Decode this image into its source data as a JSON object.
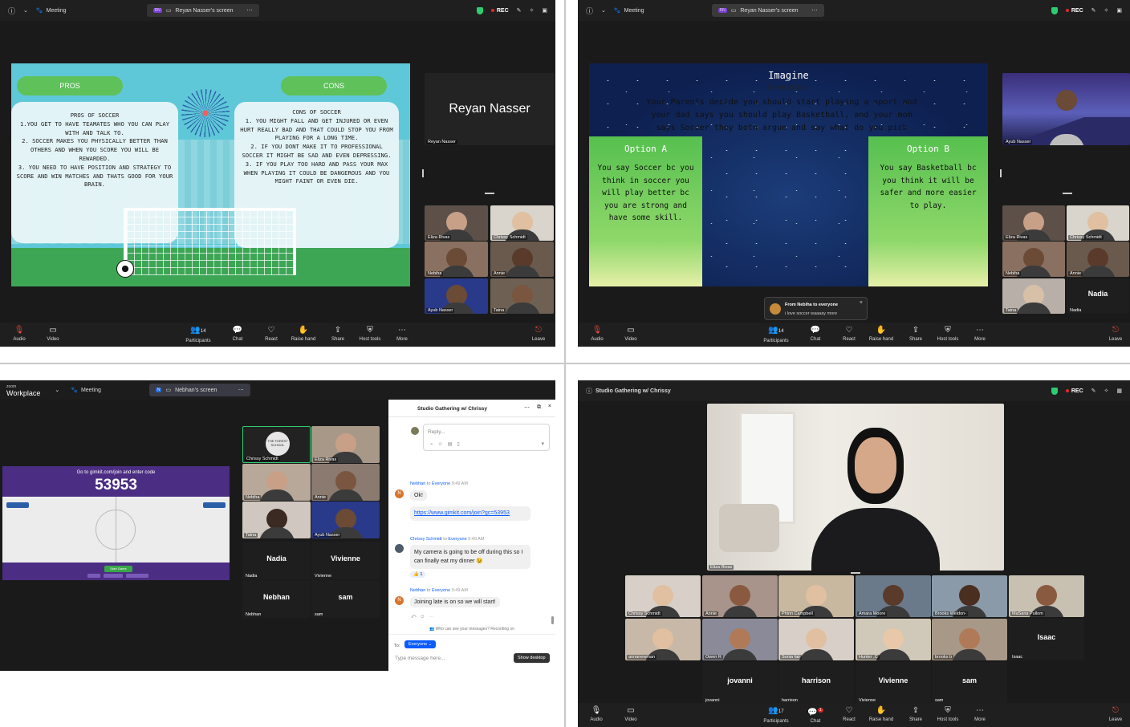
{
  "p1": {
    "meeting": "Meeting",
    "share_tab": "Reyan Nasser's screen",
    "rec": "REC",
    "slide": {
      "pros_head": "PROS",
      "cons_head": "CONS",
      "pros_title": "PROS OF SOCCER",
      "pros_items": [
        "1.YOU GET TO HAVE TEAMATES WHO YOU CAN PLAY WITH AND TALK TO.",
        "2.    SOCCER MAKES YOU PHYSICALLY BETTER THAN OTHERS AND WHEN YOU SCORE YOU WILL BE REWARDED.",
        "3.    YOU NEED TO HAVE POSITION AND STRATEGY TO SCORE AND WIN MATCHES AND THATS GOOD FOR YOUR BRAIN."
      ],
      "cons_title": "CONS OF SOCCER",
      "cons_items": [
        "1.   YOU MIGHT FALL AND GET INJURED OR EVEN HURT REALLY BAD AND THAT COULD STOP YOU FROM PLAYING FOR A LONG TIME.",
        "2.   IF YOU DONT MAKE IT TO PROFESSIONAL SOCCER IT MIGHT BE SAD AND EVEN DEPRESSING.",
        "3.   IF YOU PLAY TOO HARD AND PASS YOUR MAX WHEN PLAYING IT COULD BE DANGEROUS AND YOU MIGHT FAINT OR EVEN DIE."
      ]
    },
    "speaker_big": "Reyan Nasser",
    "speaker_small": "Reyan Nasser",
    "tiles": [
      "Eliza Rivas",
      "Chrissy Schmidt",
      "Nebiha",
      "Annie",
      "Ayub Nasser",
      "Taina"
    ]
  },
  "p2": {
    "meeting": "Meeting",
    "share_tab": "Reyan Nasser's screen",
    "rec": "REC",
    "slide": {
      "title": "Imagine",
      "sub": "Scenario:",
      "scenario": "Your Parents decide you should start playing a sport and your dad says you should play Basketball, and your mom says Soccer they both argue and say what do you pick",
      "optA_title": "Option A",
      "optA_text": "You say Soccer bc you think in soccer you will play better bc you are strong and have some skill.",
      "optB_title": "Option B",
      "optB_text": "You say Basketball bc you think it will be safer and more easier to play."
    },
    "speaker": "Ayub Nasser",
    "tiles": [
      "Eliza Rivas",
      "Chrissy Schmidt",
      "Nebiha",
      "Annie",
      "Taina",
      "Nadia"
    ],
    "tile_nadia_big": "Nadia",
    "chat_from": "From Nebiha to everyone",
    "chat_msg": "i love soccer waaaay more"
  },
  "toolbar": {
    "audio": "Audio",
    "video": "Video",
    "participants": "Participants",
    "chat": "Chat",
    "react": "React",
    "raise": "Raise hand",
    "share": "Share",
    "host": "Host tools",
    "more": "More",
    "leave": "Leave",
    "count1": "14",
    "count2": "14",
    "count4": "17",
    "chat_badge": "1"
  },
  "p3": {
    "brand_small": "zoom",
    "brand": "Workplace",
    "meeting": "Meeting",
    "share_tab": "Nebhan's screen",
    "share_initial": "N",
    "gimkit": {
      "line": "Go to gimkit.com/join and enter code",
      "code": "53953",
      "start": "Start Game"
    },
    "tiles": [
      "Chrissy Schmidt",
      "Eliza Rivas",
      "Nebiha",
      "Annie",
      "Taina",
      "Ayub Nasser"
    ],
    "logo_text": "THE FOREST SCHOOL",
    "names_big": [
      "Nadia",
      "Vivienne",
      "Nebhan",
      "sam"
    ],
    "names_small": [
      "Nadia",
      "Vivienne",
      "Nebhan",
      "sam"
    ],
    "chat": {
      "title": "Studio Gathering w/ Chrissy",
      "reply": "Reply...",
      "m1_from": "Nebhan",
      "m1_to": "to",
      "m1_everyone": "Everyone",
      "m1_time": "9:49 AM",
      "m1_text": "Ok!",
      "m1_link": "https://www.gimkit.com/join?gc=53953",
      "m2_from": "Chrissy Schmidt",
      "m2_time": "9:49 AM",
      "m2_text": "My camera is going to be off during this so I can finally eat my dinner 😉",
      "react_count": "👍 1",
      "m3_from": "Nebhan",
      "m3_time": "9:49 AM",
      "m3_text": "Joining late is on so we will start!",
      "who": "Who can see your messages? Recording on",
      "to_label": "To:",
      "to_value": "Everyone",
      "input_ph": "Type message here...",
      "show_desktop": "Show desktop",
      "avatar_n": "N"
    }
  },
  "p4": {
    "title": "Studio Gathering w/ Chrissy",
    "rec": "REC",
    "main_name": "Eliza Rivas",
    "row1": [
      "Chrissy Schmidt",
      "Annie",
      "Phinn Campbell",
      "Amara Moore",
      "Brooks Weldon-",
      "MaSana Pullom"
    ],
    "row2": [
      "annanewman",
      "Owen R",
      "Sonia fair",
      "Hunter .C",
      "brooks b",
      "Isaac"
    ],
    "isaac_big": "Isaac",
    "row3_big": [
      "jovanni",
      "harrison",
      "Vivienne",
      "sam"
    ],
    "row3_small": [
      "jovanni",
      "harrison",
      "Vivienne",
      "sam"
    ]
  },
  "colors": {
    "dark": "#1a1a1a",
    "rec_red": "#e02828",
    "zoom_blue": "#0b5cff",
    "slide_teal": "#5fc8d8",
    "slide_green": "#5ec15a"
  }
}
